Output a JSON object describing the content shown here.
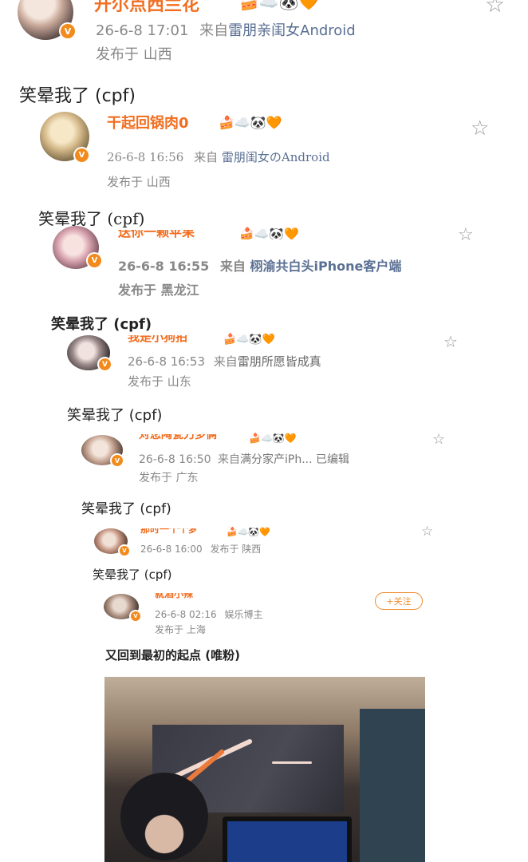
{
  "posts": [
    {
      "username": "开尔点西兰花",
      "date": "26-6-8 17:01",
      "from_prefix": "来自",
      "source": "雷朋亲闺女Android",
      "location": "发布于 山西",
      "text": "笑晕我了 (cpf)"
    },
    {
      "username": "干起回锅肉0",
      "date": "26-6-8 16:56",
      "from_prefix": "来自",
      "source": "雷朋闺女のAndroid",
      "location": "发布于 山西",
      "text": "笑晕我了 (cpf)"
    },
    {
      "username": "送你一颗苹果",
      "date": "26-6-8 16:55",
      "from_prefix": "来自",
      "source": "栩渝共白头iPhone客户端",
      "location": "发布于 黑龙江",
      "text": "笑晕我了 (cpf)"
    },
    {
      "username": "我是小狗拍",
      "date": "26-6-8 16:53",
      "from_prefix": "来自",
      "source": "雷朋所愿皆成真",
      "location": "发布于 山东",
      "text": "笑晕我了 (cpf)"
    },
    {
      "username": "对您陶瓷刀多俩",
      "date": "26-6-8 16:50",
      "from_prefix": "来自",
      "source": "满分家产iPh... 已编辑",
      "location": "发布于 广东",
      "text": "笑晕我了 (cpf)"
    },
    {
      "username": "那时一个个梦",
      "date": "26-6-8 16:00",
      "from_prefix": "",
      "source": "",
      "location": "发布于 陕西",
      "text": "笑晕我了 (cpf)"
    },
    {
      "username": "就酒小辣",
      "date": "26-6-8 02:16",
      "from_prefix": "",
      "source": "娱乐博主",
      "location": "发布于 上海",
      "text": "又回到最初的起点 (唯粉)"
    }
  ],
  "follow_label": "+关注",
  "emoji": "🍰☁️🐼🧡",
  "icons": {
    "star": "star-outline-icon",
    "verified": "verified-v-icon"
  },
  "colors": {
    "username": "#f26d1f",
    "verified": "#f28a1c",
    "source": "#5a6f93",
    "meta": "#888888"
  }
}
